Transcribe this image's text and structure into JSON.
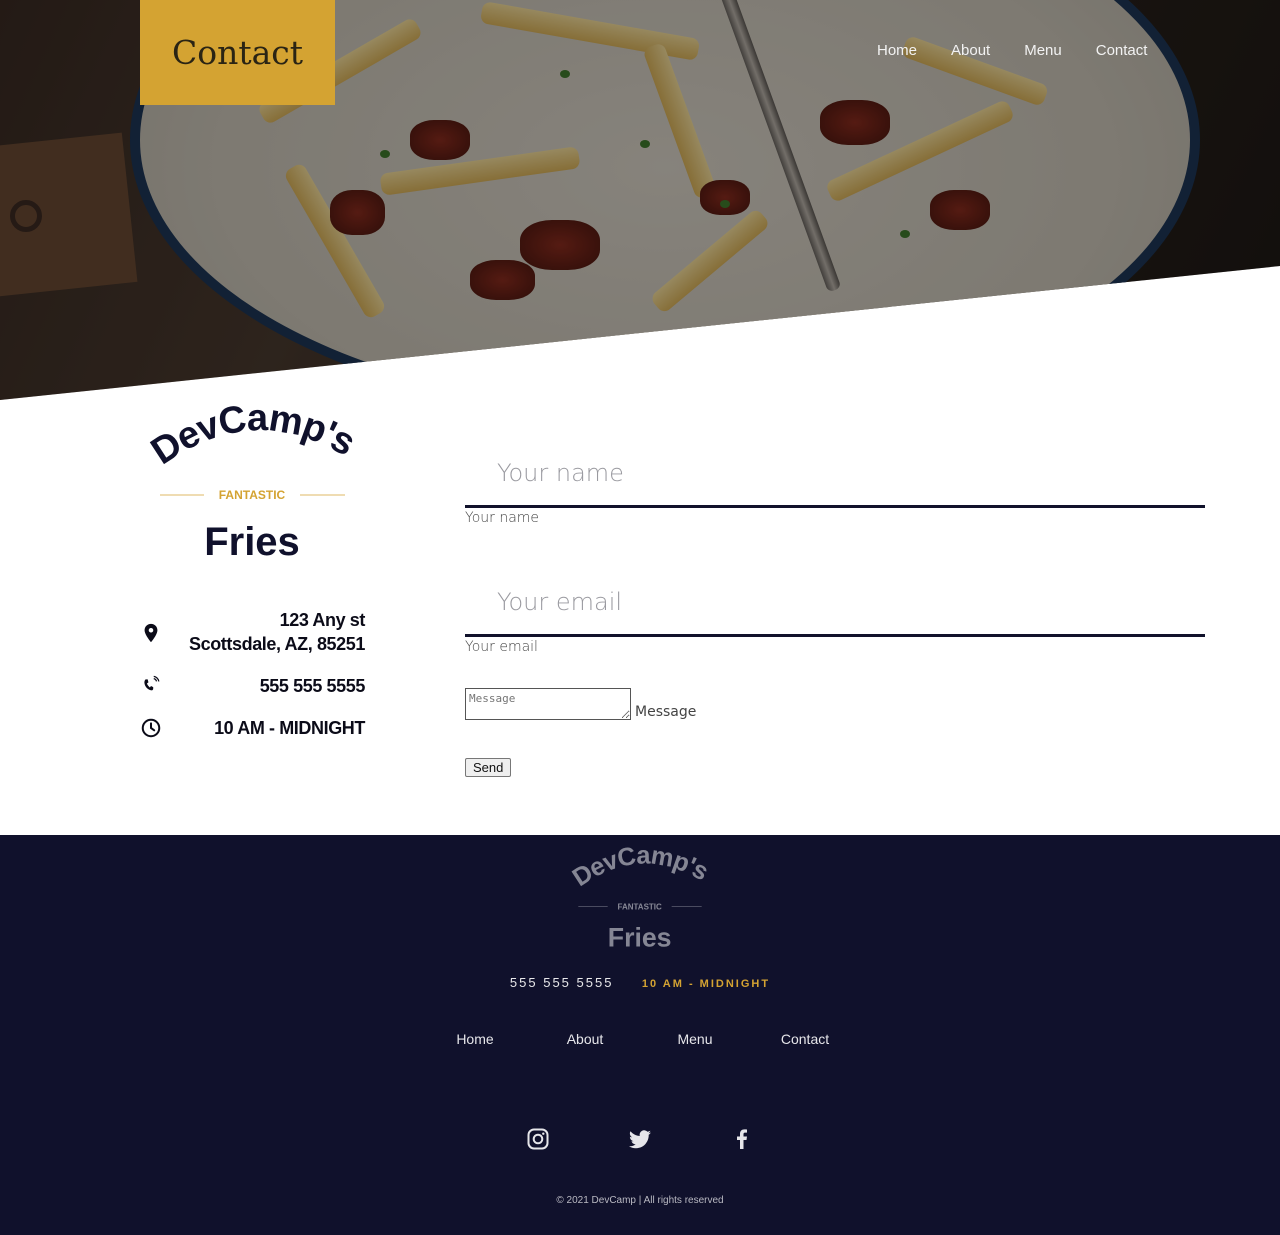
{
  "page_title": "Contact",
  "nav": [
    {
      "label": "Home"
    },
    {
      "label": "About"
    },
    {
      "label": "Menu"
    },
    {
      "label": "Contact"
    }
  ],
  "brand": {
    "name_top": "DevCamp's",
    "tagline": "FANTASTIC",
    "name_bottom": "Fries",
    "accent": "#d4a332",
    "navy": "#10112c"
  },
  "contact": {
    "address_line1": "123 Any st",
    "address_line2": "Scottsdale, AZ, 85251",
    "phone": "555 555 5555",
    "hours": "10 AM - MIDNIGHT",
    "icons": [
      "map-pin-icon",
      "phone-icon",
      "clock-icon"
    ]
  },
  "form": {
    "name_placeholder": "Your name",
    "name_label": "Your name",
    "email_placeholder": "Your email",
    "email_label": "Your email",
    "message_placeholder": "Message",
    "message_label": "Message",
    "send_label": "Send"
  },
  "footer": {
    "phone": "555 555 5555",
    "hours": "10 AM - MIDNIGHT",
    "nav": [
      {
        "label": "Home"
      },
      {
        "label": "About"
      },
      {
        "label": "Menu"
      },
      {
        "label": "Contact"
      }
    ],
    "social": [
      "instagram-icon",
      "twitter-icon",
      "facebook-icon"
    ],
    "copyright": "© 2021 DevCamp | All rights reserved"
  }
}
